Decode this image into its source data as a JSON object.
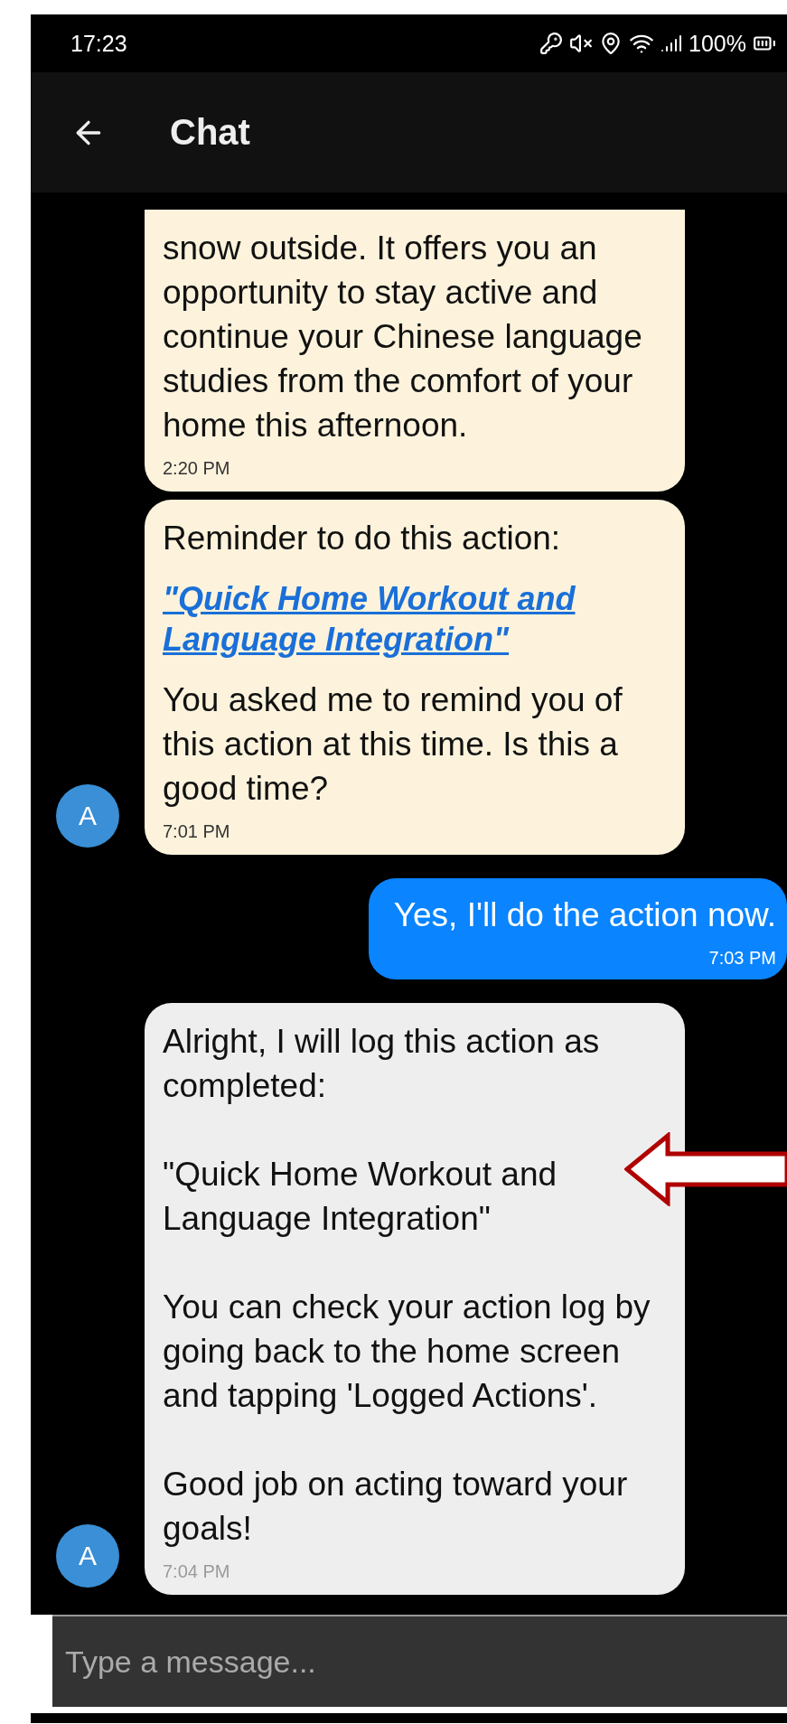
{
  "status_bar": {
    "time": "17:23",
    "battery": "100%"
  },
  "app_bar": {
    "title": "Chat"
  },
  "messages": [
    {
      "kind": "reminder",
      "paragraphs": [
        {
          "kind": "text",
          "text": "snow outside. It offers you an opportunity to stay active and continue your Chinese language studies from the comfort of your home this afternoon."
        }
      ],
      "time": "2:20 PM"
    },
    {
      "kind": "reminder",
      "avatar": "A",
      "paragraphs": [
        {
          "kind": "text",
          "text": "Reminder to do this action:"
        },
        {
          "kind": "link",
          "text": "\"Quick Home Workout and Language Integration\""
        },
        {
          "kind": "text",
          "text": "You asked me to remind you of this action at this time. Is this a good time?"
        }
      ],
      "time": "7:01 PM"
    },
    {
      "kind": "user",
      "paragraphs": [
        {
          "kind": "text",
          "text": "Yes, I'll do the action now."
        }
      ],
      "time": "7:03 PM"
    },
    {
      "kind": "reply",
      "avatar": "A",
      "paragraphs": [
        {
          "kind": "text",
          "text": "Alright, I will log this action as completed:"
        },
        {
          "kind": "text",
          "text": "\"Quick Home Workout and Language Integration\""
        },
        {
          "kind": "text",
          "text": "You can check your action log by going back to the home screen and tapping 'Logged Actions'."
        },
        {
          "kind": "text",
          "text": "Good job on acting toward your goals!"
        }
      ],
      "time": "7:04 PM"
    }
  ],
  "composer": {
    "placeholder": "Type a message..."
  }
}
